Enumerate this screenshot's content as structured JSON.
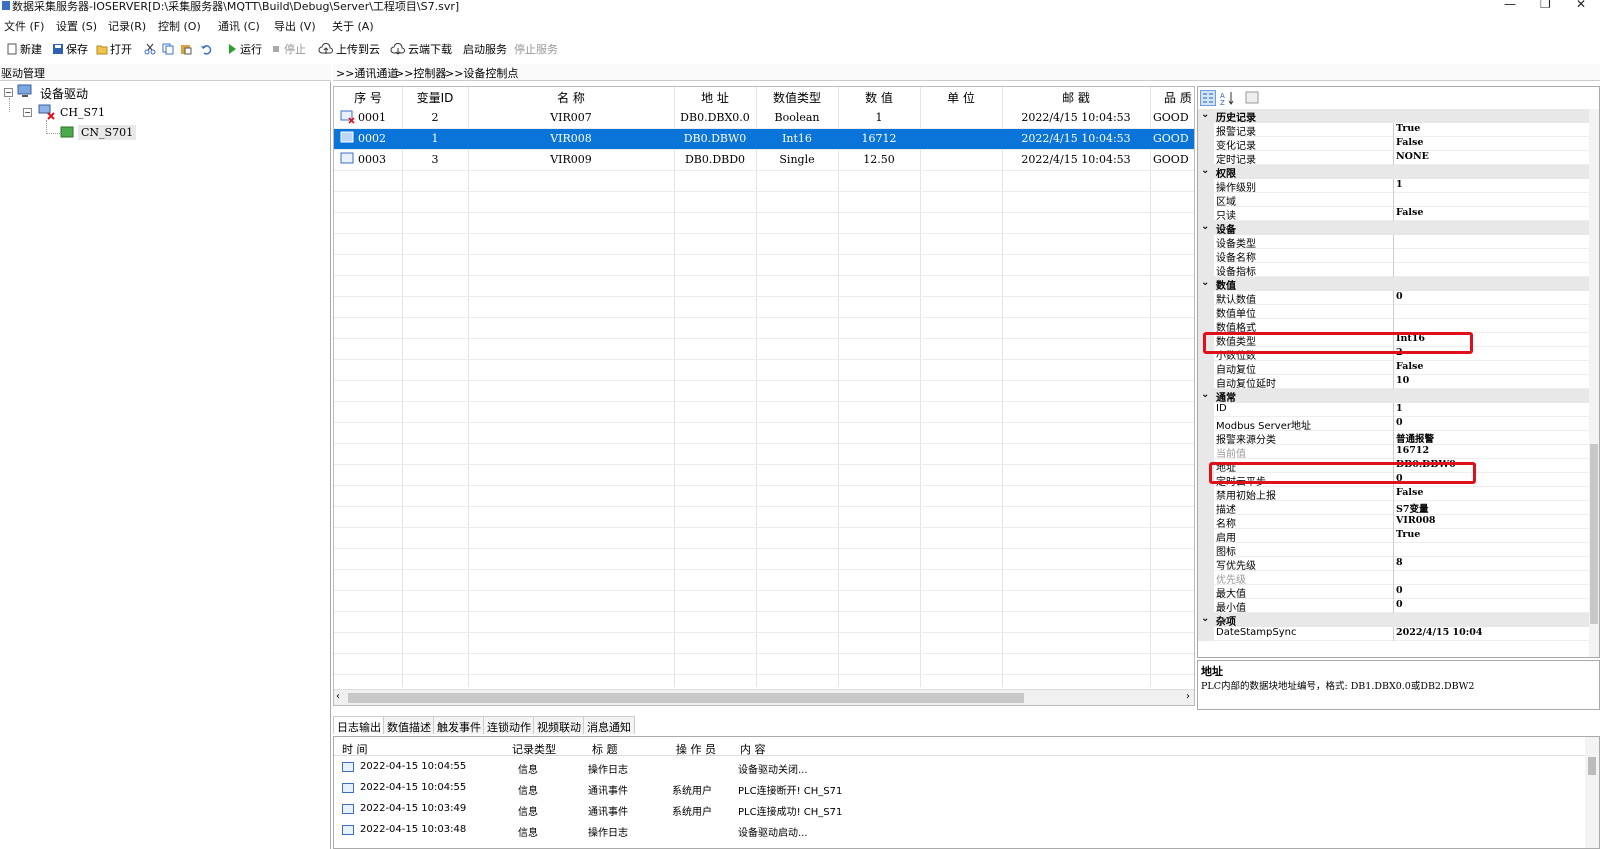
{
  "window": {
    "title": "数据采集服务器-IOSERVER[D:\\采集服务器\\MQTT\\Build\\Debug\\Server\\工程项目\\S7.svr]",
    "minimize": "—",
    "restore": "❐",
    "close": "✕"
  },
  "menu": [
    "文件 (F)",
    "设置 (S)",
    "记录(R)",
    "控制 (O)",
    "通讯 (C)",
    "导出 (V)",
    "关于 (A)"
  ],
  "toolbar": {
    "new": "新建",
    "save": "保存",
    "open": "打开",
    "run": "运行",
    "stop": "停止",
    "upload": "上传到云",
    "download": "云端下载",
    "start_service": "启动服务",
    "stop_service": "停止服务"
  },
  "left_header": "驱动管理",
  "tree": {
    "root": "设备驱动",
    "channel": "CH_S71",
    "device": "CN_S701"
  },
  "breadcrumb": [
    ">>通讯通道",
    ">>控制器",
    ">>设备控制点"
  ],
  "grid": {
    "columns": [
      "序  号",
      "变量ID",
      "名  称",
      "地  址",
      "数值类型",
      "数  值",
      "单  位",
      "邮  戳",
      "品  质"
    ],
    "rows": [
      {
        "seq": "0001",
        "id": "2",
        "name": "VIR007",
        "addr": "DB0.DBX0.0",
        "type": "Boolean",
        "value": "1",
        "unit": "",
        "stamp": "2022/4/15 10:04:53",
        "quality": "GOOD"
      },
      {
        "seq": "0002",
        "id": "1",
        "name": "VIR008",
        "addr": "DB0.DBW0",
        "type": "Int16",
        "value": "16712",
        "unit": "",
        "stamp": "2022/4/15 10:04:53",
        "quality": "GOOD"
      },
      {
        "seq": "0003",
        "id": "3",
        "name": "VIR009",
        "addr": "DB0.DBD0",
        "type": "Single",
        "value": "12.50",
        "unit": "",
        "stamp": "2022/4/15 10:04:53",
        "quality": "GOOD"
      }
    ]
  },
  "props": {
    "rows": [
      {
        "kind": "cat",
        "name": "历史记录"
      },
      {
        "kind": "prop",
        "name": "报警记录",
        "value": "True"
      },
      {
        "kind": "prop",
        "name": "变化记录",
        "value": "False"
      },
      {
        "kind": "prop",
        "name": "定时记录",
        "value": "NONE"
      },
      {
        "kind": "cat",
        "name": "权限"
      },
      {
        "kind": "prop",
        "name": "操作级别",
        "value": "1"
      },
      {
        "kind": "prop",
        "name": "区域",
        "value": ""
      },
      {
        "kind": "prop",
        "name": "只读",
        "value": "False"
      },
      {
        "kind": "cat",
        "name": "设备"
      },
      {
        "kind": "prop",
        "name": "设备类型",
        "value": ""
      },
      {
        "kind": "prop",
        "name": "设备名称",
        "value": ""
      },
      {
        "kind": "prop",
        "name": "设备指标",
        "value": ""
      },
      {
        "kind": "cat",
        "name": "数值"
      },
      {
        "kind": "prop",
        "name": "默认数值",
        "value": "0"
      },
      {
        "kind": "prop",
        "name": "数值单位",
        "value": ""
      },
      {
        "kind": "prop",
        "name": "数值格式",
        "value": ""
      },
      {
        "kind": "prop",
        "name": "数值类型",
        "value": "Int16"
      },
      {
        "kind": "prop",
        "name": "小数位数",
        "value": "2"
      },
      {
        "kind": "prop",
        "name": "自动复位",
        "value": "False"
      },
      {
        "kind": "prop",
        "name": "自动复位延时",
        "value": "10"
      },
      {
        "kind": "cat",
        "name": "通常"
      },
      {
        "kind": "prop",
        "name": "ID",
        "value": "1"
      },
      {
        "kind": "prop",
        "name": "Modbus Server地址",
        "value": "0"
      },
      {
        "kind": "prop",
        "name": "报警来源分类",
        "value": "普通报警"
      },
      {
        "kind": "prop",
        "name": "当前值",
        "value": "16712",
        "muted": true
      },
      {
        "kind": "prop",
        "name": "地址",
        "value": "DB0.DBW0"
      },
      {
        "kind": "prop",
        "name": "定时云平步",
        "value": "0"
      },
      {
        "kind": "prop",
        "name": "禁用初始上报",
        "value": "False"
      },
      {
        "kind": "prop",
        "name": "描述",
        "value": "S7变量"
      },
      {
        "kind": "prop",
        "name": "名称",
        "value": "VIR008"
      },
      {
        "kind": "prop",
        "name": "启用",
        "value": "True"
      },
      {
        "kind": "prop",
        "name": "图标",
        "value": ""
      },
      {
        "kind": "prop",
        "name": "写优先级",
        "value": "8"
      },
      {
        "kind": "prop",
        "name": "优先级",
        "value": "",
        "muted": true
      },
      {
        "kind": "prop",
        "name": "最大值",
        "value": "0"
      },
      {
        "kind": "prop",
        "name": "最小值",
        "value": "0"
      },
      {
        "kind": "cat",
        "name": "杂项"
      },
      {
        "kind": "prop",
        "name": "DateStampSync",
        "value": "2022/4/15 10:04"
      }
    ]
  },
  "help": {
    "title": "地址",
    "text": "PLC内部的数据块地址编号，格式: DB1.DBX0.0或DB2.DBW2"
  },
  "bottom_tabs": [
    "日志输出",
    "数值描述",
    "触发事件",
    "连锁动作",
    "视频联动",
    "消息通知"
  ],
  "log": {
    "columns": [
      "时    间",
      "记录类型",
      "标    题",
      "操 作 员",
      "内    容"
    ],
    "rows": [
      {
        "time": "2022-04-15 10:04:55",
        "type": "信息",
        "title": "操作日志",
        "operator": "",
        "content": "设备驱动关闭..."
      },
      {
        "time": "2022-04-15 10:04:55",
        "type": "信息",
        "title": "通讯事件",
        "operator": "系统用户",
        "content": "PLC连接断开! CH_S71"
      },
      {
        "time": "2022-04-15 10:03:49",
        "type": "信息",
        "title": "通讯事件",
        "operator": "系统用户",
        "content": "PLC连接成功! CH_S71"
      },
      {
        "time": "2022-04-15 10:03:48",
        "type": "信息",
        "title": "操作日志",
        "operator": "",
        "content": "设备驱动启动..."
      }
    ]
  },
  "colors": {
    "selection": "#0a74d9",
    "highlight_box": "#e0101a"
  }
}
